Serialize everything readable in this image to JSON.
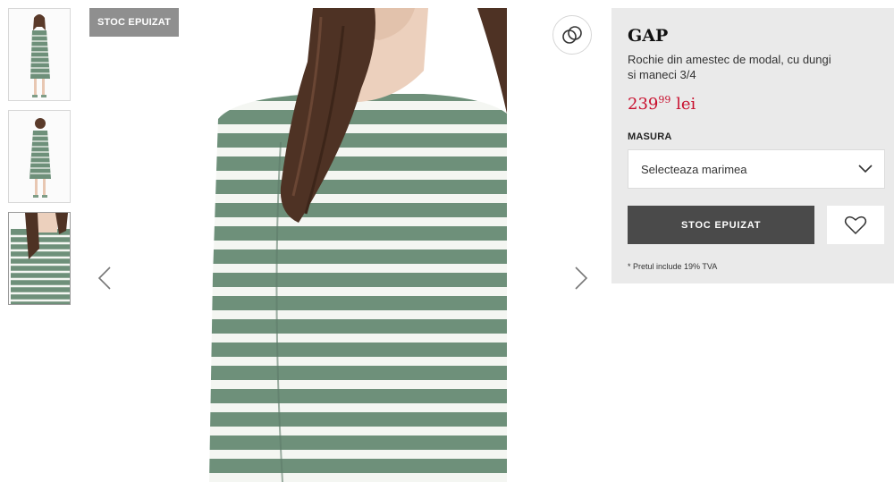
{
  "gallery": {
    "badge": "STOC EPUIZAT",
    "thumbnails": [
      {
        "view": "full-front"
      },
      {
        "view": "full-back"
      },
      {
        "view": "close-up",
        "active": true
      }
    ]
  },
  "product": {
    "brand": "GAP",
    "title": "Rochie din amestec de modal, cu dungi si maneci 3/4",
    "price": {
      "integer": "239",
      "decimals": "99",
      "currency": "lei"
    },
    "size_label": "MASURA",
    "size_select": {
      "placeholder": "Selecteaza marimea"
    },
    "out_of_stock_button": "STOC EPUIZAT",
    "vat_note": "* Pretul include 19% TVA"
  },
  "colors": {
    "price": "#c8102e",
    "stripe_green": "#6e907a",
    "stripe_white": "#f4f6f2",
    "button_dark": "#4a4a4a",
    "panel_bg": "#eaeaea"
  },
  "icons": {
    "share": "link-rings-icon",
    "wishlist": "heart-outline-icon",
    "prev": "chevron-left-icon",
    "next": "chevron-right-icon",
    "dropdown": "chevron-down-icon"
  }
}
